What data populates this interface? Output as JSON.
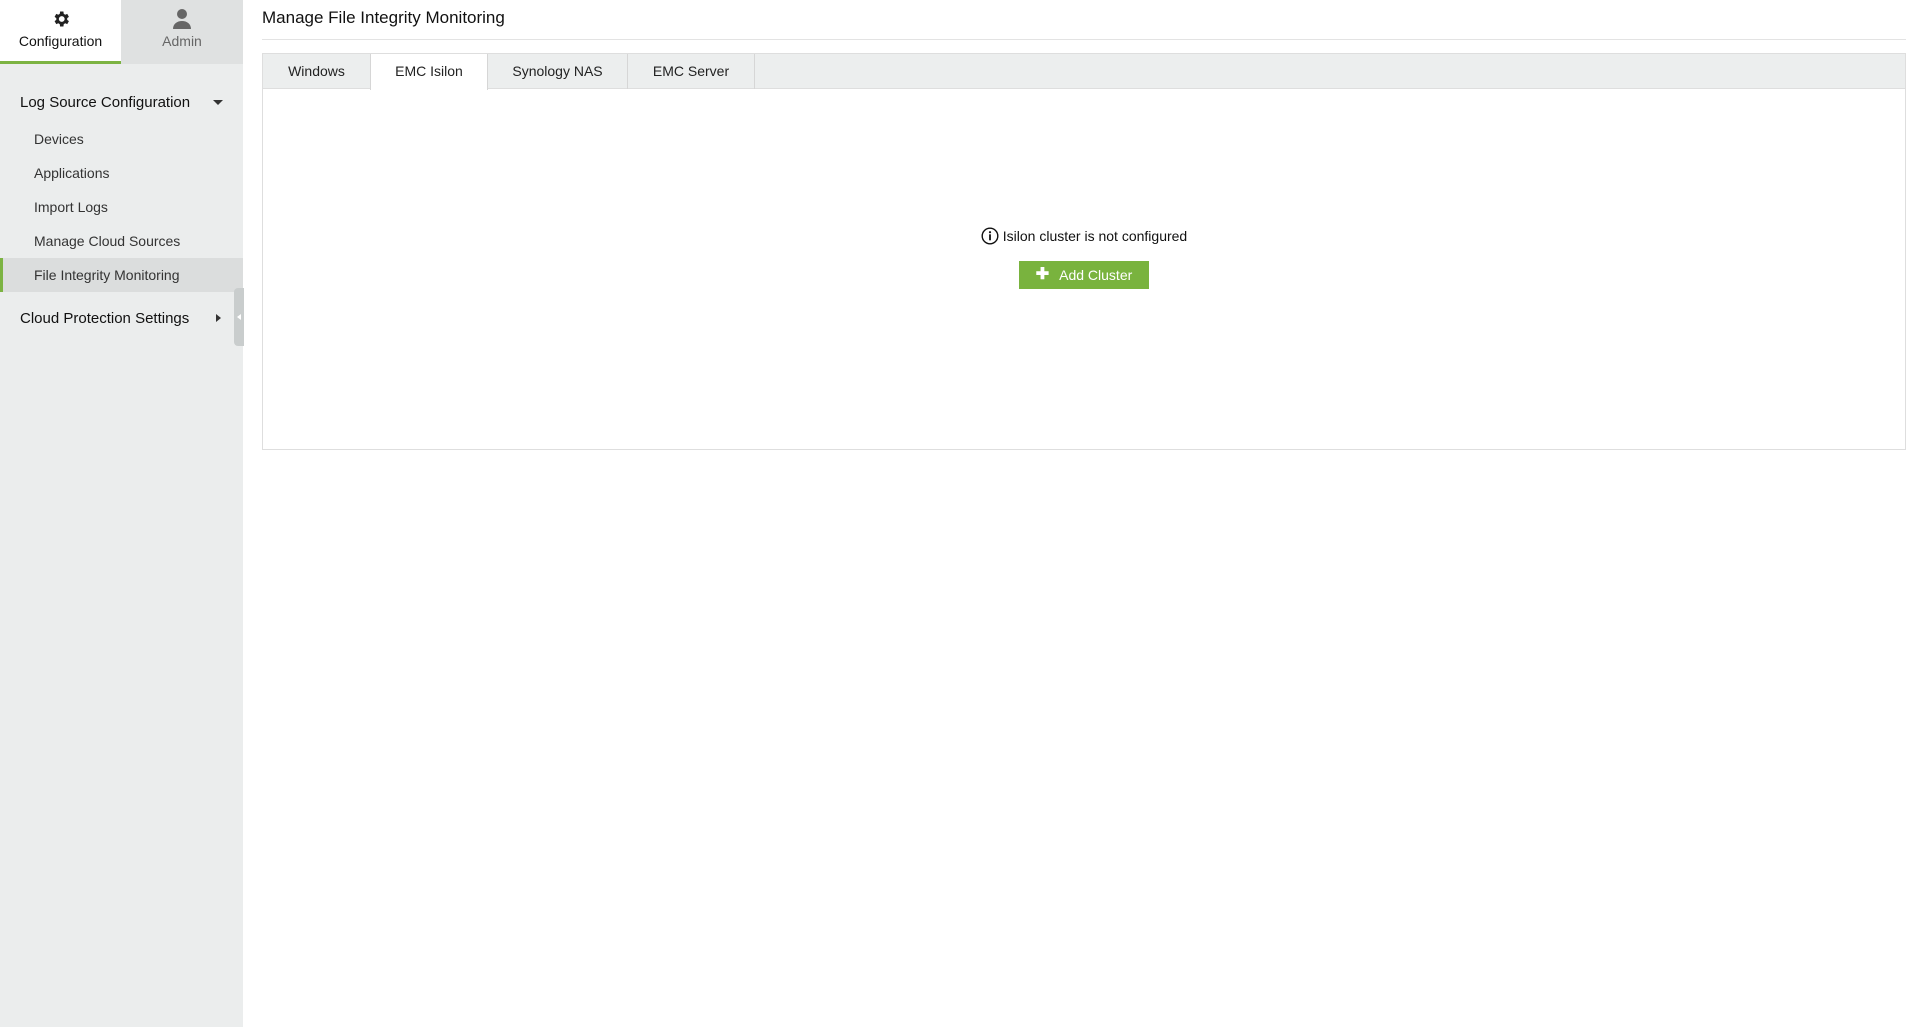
{
  "top_tabs": [
    {
      "label": "Configuration",
      "icon": "gear-icon",
      "active": true
    },
    {
      "label": "Admin",
      "icon": "user-icon",
      "active": false
    }
  ],
  "sidebar": {
    "section1": {
      "title": "Log Source Configuration",
      "items": [
        {
          "label": "Devices"
        },
        {
          "label": "Applications"
        },
        {
          "label": "Import Logs"
        },
        {
          "label": "Manage Cloud Sources"
        },
        {
          "label": "File Integrity Monitoring"
        }
      ]
    },
    "section2": {
      "title": "Cloud Protection Settings"
    }
  },
  "main": {
    "title": "Manage File Integrity Monitoring",
    "tabs": [
      {
        "label": "Windows"
      },
      {
        "label": "EMC Isilon"
      },
      {
        "label": "Synology NAS"
      },
      {
        "label": "EMC Server"
      }
    ],
    "active_tab": "EMC Isilon",
    "empty_message": "Isilon cluster is not configured",
    "add_button_label": "Add Cluster"
  },
  "colors": {
    "accent": "#7cb342",
    "button": "#79b33e",
    "sidebar_bg": "#ebeded"
  }
}
